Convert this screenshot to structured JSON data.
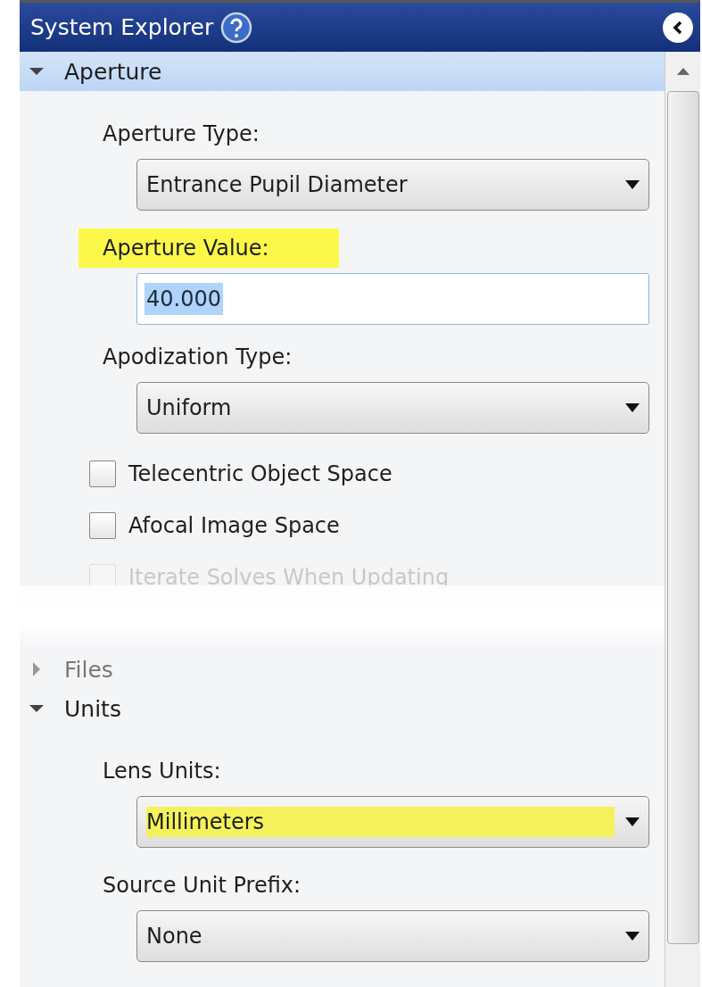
{
  "title": "System Explorer",
  "sections": [
    {
      "title": "Aperture",
      "expanded": true,
      "items": [
        {
          "kind": "dropdown",
          "label": "Aperture Type:",
          "value": "Entrance Pupil Diameter",
          "label_highlighted": false,
          "value_highlighted": false
        },
        {
          "kind": "field",
          "label": "Aperture Value:",
          "value": "40.000",
          "label_highlighted": true,
          "value_selected": true
        },
        {
          "kind": "dropdown",
          "label": "Apodization Type:",
          "value": "Uniform",
          "label_highlighted": false,
          "value_highlighted": false
        },
        {
          "kind": "checkbox",
          "label": "Telecentric Object Space",
          "checked": false,
          "faded": false
        },
        {
          "kind": "checkbox",
          "label": "Afocal Image Space",
          "checked": false,
          "faded": false
        },
        {
          "kind": "checkbox",
          "label": "Iterate Solves When Updating",
          "checked": false,
          "faded": true
        }
      ]
    },
    {
      "title": "Files",
      "expanded": false
    },
    {
      "title": "Units",
      "expanded": true,
      "items": [
        {
          "kind": "dropdown",
          "label": "Lens Units:",
          "value": "Millimeters",
          "label_highlighted": false,
          "value_highlighted": true
        },
        {
          "kind": "dropdown",
          "label": "Source Unit Prefix:",
          "value": "None",
          "label_highlighted": false,
          "value_highlighted": false
        }
      ]
    }
  ]
}
